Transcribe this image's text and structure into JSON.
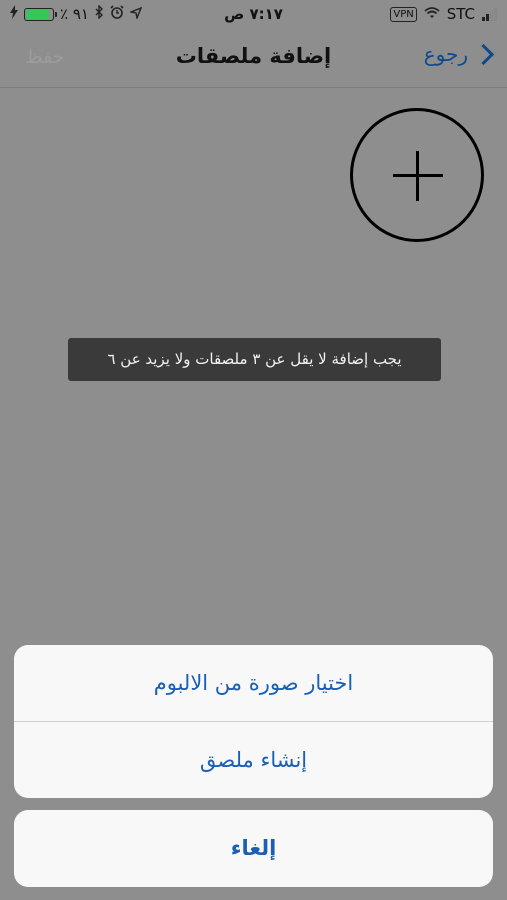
{
  "status_bar": {
    "battery_percent": "٪ ٩١",
    "battery_level": 0.91,
    "time": "٧:١٧ ص",
    "vpn": "VPN",
    "carrier": "STC"
  },
  "nav": {
    "title": "إضافة ملصقات",
    "back_label": "رجوع",
    "save_label": "حفظ"
  },
  "toast": {
    "message": "يجب إضافة لا يقل عن ٣ ملصقات ولا يزيد عن ٦"
  },
  "action_sheet": {
    "options": [
      {
        "label": "اختيار صورة من الالبوم"
      },
      {
        "label": "إنشاء ملصق"
      }
    ],
    "cancel_label": "إلغاء"
  },
  "colors": {
    "accent": "#1a5fb4",
    "overlay": "#8e8e8e",
    "battery": "#34c759"
  },
  "icons": [
    "charging-icon",
    "bluetooth-icon",
    "alarm-icon",
    "location-icon",
    "wifi-icon",
    "signal-icon",
    "chevron-right-icon",
    "plus-icon"
  ]
}
